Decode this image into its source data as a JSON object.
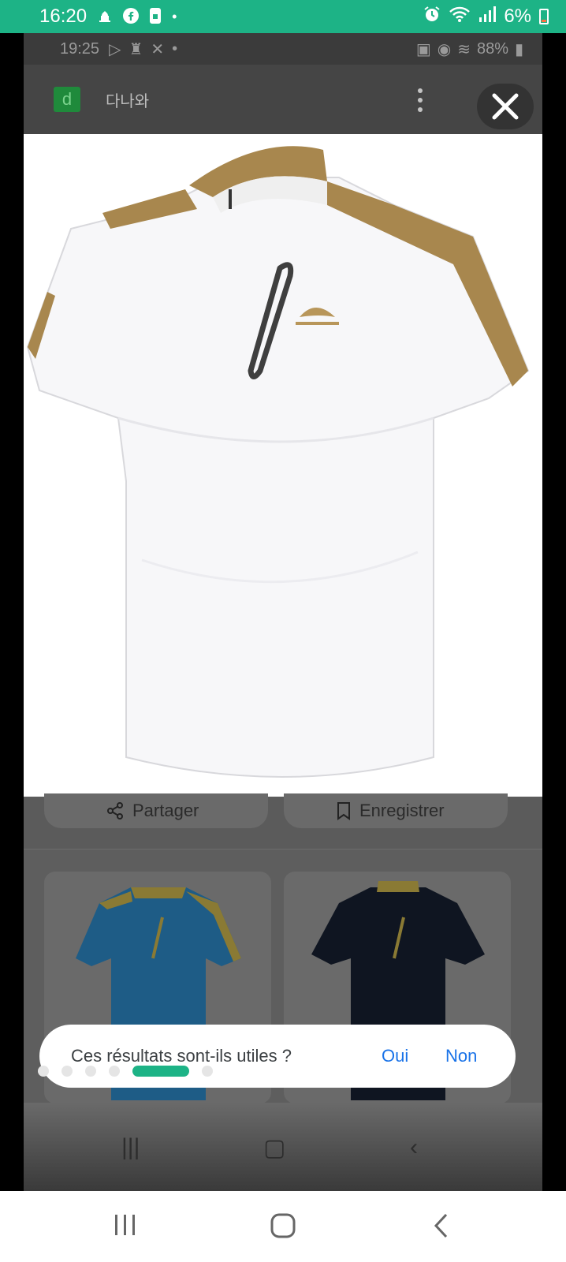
{
  "status_bar": {
    "time": "16:20",
    "battery": "6%",
    "icons": [
      "mosque-icon",
      "facebook-icon",
      "messenger-icon",
      "dot-icon",
      "alarm-icon",
      "wifi-icon",
      "signal-icon",
      "battery-icon"
    ]
  },
  "inner_status_bar": {
    "time": "19:25",
    "battery": "88%"
  },
  "header": {
    "logo_letter": "d",
    "site_name": "다나와"
  },
  "product": {
    "description_icon": "shirt-image"
  },
  "actions": {
    "share_label": "Partager",
    "save_label": "Enregistrer"
  },
  "feedback": {
    "question": "Ces résultats sont-ils utiles ?",
    "yes_label": "Oui",
    "no_label": "Non"
  },
  "carousel": {
    "dot_count": 7,
    "active_index": 4
  },
  "colors": {
    "accent": "#1db386",
    "link": "#1a73e8",
    "shirt_accent": "#a8874e"
  }
}
